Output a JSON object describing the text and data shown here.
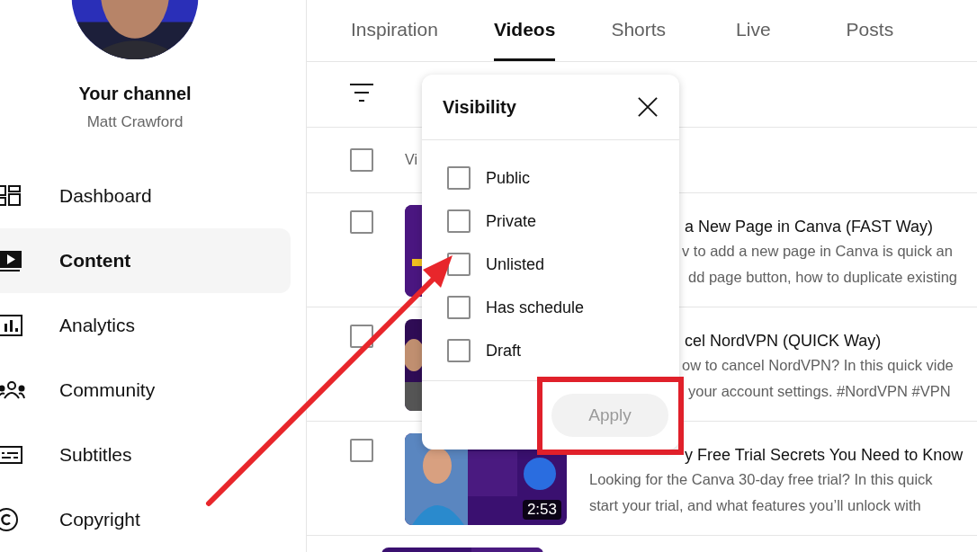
{
  "sidebar": {
    "channel_title": "Your channel",
    "channel_name": "Matt Crawford",
    "items": [
      {
        "label": "Dashboard",
        "selected": false
      },
      {
        "label": "Content",
        "selected": true
      },
      {
        "label": "Analytics",
        "selected": false
      },
      {
        "label": "Community",
        "selected": false
      },
      {
        "label": "Subtitles",
        "selected": false
      },
      {
        "label": "Copyright",
        "selected": false
      }
    ]
  },
  "tabs": [
    {
      "label": "Inspiration",
      "selected": false
    },
    {
      "label": "Videos",
      "selected": true
    },
    {
      "label": "Shorts",
      "selected": false
    },
    {
      "label": "Live",
      "selected": false
    },
    {
      "label": "Posts",
      "selected": false
    }
  ],
  "table": {
    "header": {
      "checked": false,
      "label": "Vi"
    },
    "rows": [
      {
        "checked": false,
        "title": "a New Page in Canva (FAST Way)",
        "description": [
          "v to add a new page in Canva is quick an",
          "dd page button, how to duplicate existing"
        ]
      },
      {
        "checked": false,
        "title": "cel NordVPN (QUICK Way)",
        "description": [
          "ow to cancel NordVPN? In this quick vide",
          "your account settings. #NordVPN #VPN"
        ]
      },
      {
        "checked": false,
        "title": "y Free Trial Secrets You Need to Know",
        "description": [
          "Looking for the Canva 30-day free trial? In this quick",
          "start your trial, and what features you’ll unlock with"
        ],
        "duration": "2:53"
      }
    ]
  },
  "filter_popup": {
    "title": "Visibility",
    "options": [
      {
        "label": "Public",
        "checked": false
      },
      {
        "label": "Private",
        "checked": false
      },
      {
        "label": "Unlisted",
        "checked": false
      },
      {
        "label": "Has schedule",
        "checked": false
      },
      {
        "label": "Draft",
        "checked": false
      }
    ],
    "apply_button": {
      "label": "Apply",
      "disabled": true
    }
  }
}
